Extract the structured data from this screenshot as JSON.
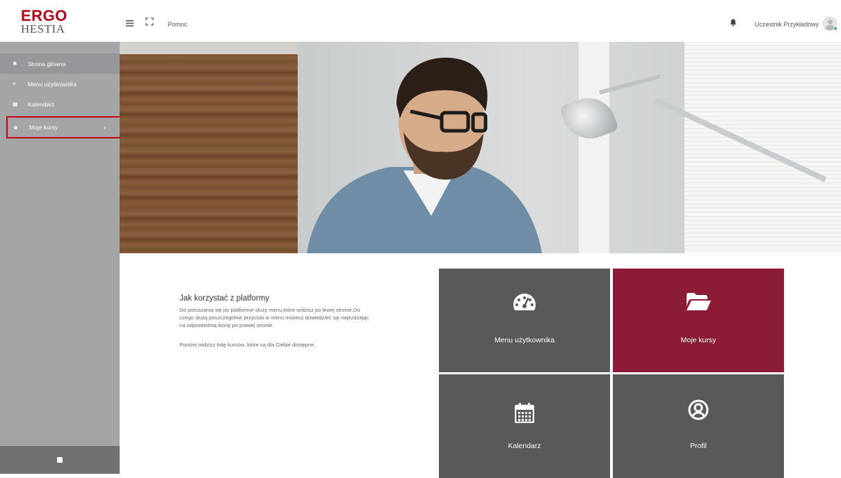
{
  "brand": {
    "line1": "ERGO",
    "line2": "HESTIA",
    "primary_color": "#b3001b"
  },
  "topbar": {
    "menu_icon": "hamburger-icon",
    "fullscreen_icon": "expand-icon",
    "help_label": "Pomoc",
    "bell_icon": "bell-icon",
    "user_name": "Uczestnik Przykładowy"
  },
  "sidebar": {
    "items": [
      {
        "label": "Strona główna",
        "icon": "home-icon",
        "glyph": "✱"
      },
      {
        "label": "Menu użytkownika",
        "icon": "dashboard-icon",
        "glyph": "◓"
      },
      {
        "label": "Kalendarz",
        "icon": "calendar-icon",
        "glyph": "▦"
      },
      {
        "label": "Moje kursy",
        "icon": "folder-icon",
        "glyph": "■",
        "chevron": "›"
      }
    ],
    "highlight_color": "#c40012"
  },
  "intro": {
    "title": "Jak korzystać z platformy",
    "paragraph1": "Do poruszania się po platformie służy menu,które widzisz po lewej stronie.Do czego służą poszczególnie przyciski w menu możesz dowiedzieć się najeżdżając na odpowiednią ikonę po prawej stronie.",
    "paragraph2": "Poniżej widzisz listę kursów, które są dla Ciebie dostępne."
  },
  "tiles": [
    {
      "label": "Menu użytkownika",
      "icon": "dashboard-icon",
      "color": "#58595b"
    },
    {
      "label": "Moje kursy",
      "icon": "folder-open-icon",
      "color": "#8b1b36"
    },
    {
      "label": "Kalendarz",
      "icon": "calendar-icon",
      "color": "#58595b"
    },
    {
      "label": "Profil",
      "icon": "user-circle-icon",
      "color": "#58595b"
    }
  ]
}
